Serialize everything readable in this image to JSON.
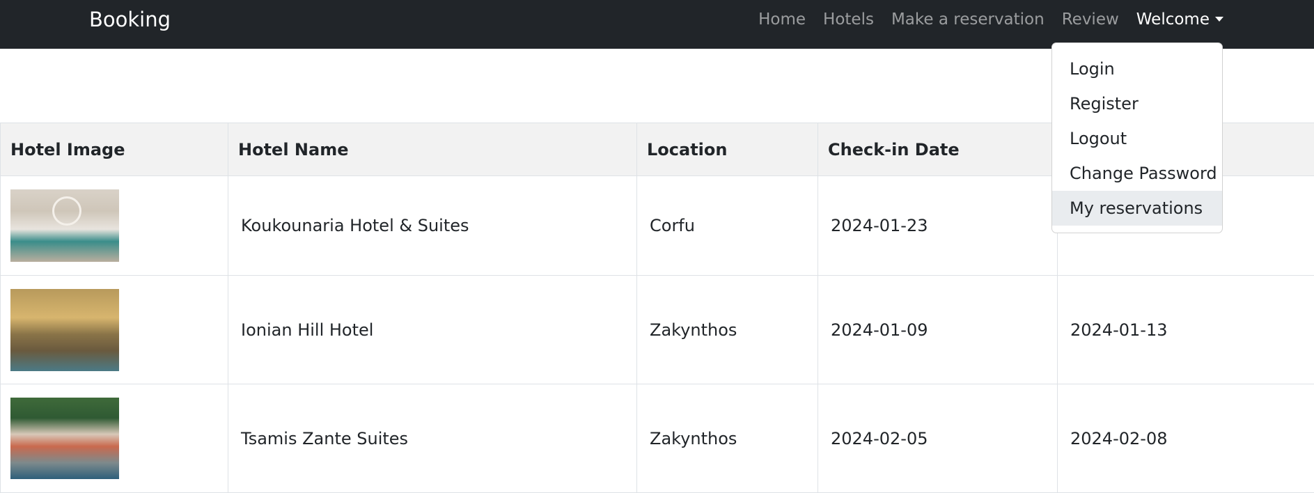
{
  "navbar": {
    "brand": "Booking",
    "links": [
      "Home",
      "Hotels",
      "Make a reservation",
      "Review"
    ],
    "welcome": "Welcome"
  },
  "dropdown": {
    "items": [
      "Login",
      "Register",
      "Logout",
      "Change Password",
      "My reservations"
    ],
    "highlighted": "My reservations"
  },
  "table": {
    "headers": [
      "Hotel Image",
      "Hotel Name",
      "Location",
      "Check-in Date",
      ""
    ],
    "rows": [
      {
        "name": "Koukounaria Hotel & Suites",
        "location": "Corfu",
        "check_in": "2024-01-23",
        "check_out": ""
      },
      {
        "name": "Ionian Hill Hotel",
        "location": "Zakynthos",
        "check_in": "2024-01-09",
        "check_out": "2024-01-13"
      },
      {
        "name": "Tsamis Zante Suites",
        "location": "Zakynthos",
        "check_in": "2024-02-05",
        "check_out": "2024-02-08"
      }
    ]
  },
  "colors": {
    "navbar_bg": "#212529",
    "header_bg": "#f2f2f2",
    "dropdown_highlight": "#e9ecef"
  }
}
